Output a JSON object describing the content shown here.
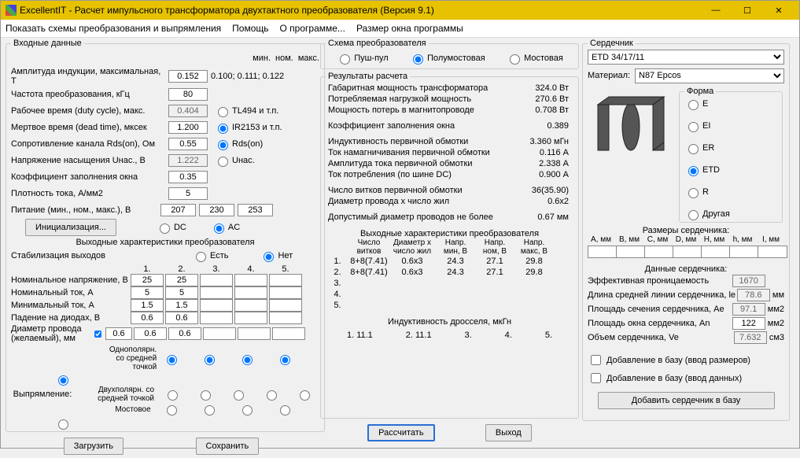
{
  "title": "ExcellentIT - Расчет импульсного трансформатора двухтактного преобразователя (Версия 9.1)",
  "menu": [
    "Показать схемы преобразования и выпрямления",
    "Помощь",
    "О программе...",
    "Размер окна программы"
  ],
  "sec": {
    "input": "Входные данные",
    "scheme": "Схема преобразователя",
    "results": "Результаты расчета",
    "outchar": "Выходные характеристики преобразователя",
    "outchar2": "Выходные характеристики преобразователя",
    "ind": "Индуктивность дросселя, мкГн",
    "core": "Сердечник",
    "coresize": "Размеры сердечника:",
    "coredata": "Данные сердечника:",
    "shape": "Форма"
  },
  "in": {
    "minnommax": [
      "мин.",
      "ном.",
      "макс."
    ],
    "ampl": "Амплитуда индукции, максимальная, Т",
    "ampl_v": "0.152",
    "ampl_ref": "0.100; 0.111; 0.122",
    "freq": "Частота преобразования, кГц",
    "freq_v": "80",
    "duty": "Рабочее время (duty cycle), макс.",
    "duty_v": "0.404",
    "tl": "TL494 и т.п.",
    "dead": "Мертвое время (dead time), мксек",
    "dead_v": "1.200",
    "ir": "IR2153 и т.п.",
    "rds": "Сопротивление канала Rds(on), Ом",
    "rds_v": "0.55",
    "rdson": "Rds(on)",
    "unac": "Напряжение насыщения Uнас., В",
    "unac_v": "1.222",
    "unac_r": "Uнас.",
    "kfill": "Коэффициент заполнения окна",
    "kfill_v": "0.35",
    "jdens": "Плотность тока, А/мм2",
    "jdens_v": "5",
    "power": "Питание (мин., ном., макс.), В",
    "p1": "207",
    "p2": "230",
    "p3": "253",
    "init": "Инициализация...",
    "dc": "DC",
    "ac": "AC",
    "stab": "Стабилизация выходов",
    "yes": "Есть",
    "no": "Нет",
    "cols": [
      "1.",
      "2.",
      "3.",
      "4.",
      "5."
    ],
    "vnom": "Номинальное напряжение, В",
    "vnom_v": [
      "25",
      "25",
      "",
      "",
      ""
    ],
    "inom": "Номинальный ток, А",
    "inom_v": [
      "5",
      "5",
      "",
      "",
      ""
    ],
    "imin": "Минимальный ток, А",
    "imin_v": [
      "1.5",
      "1.5",
      "",
      "",
      ""
    ],
    "diode": "Падение на диодах, В",
    "diode_v": [
      "0.6",
      "0.6",
      "",
      "",
      ""
    ],
    "wdia": "Диаметр провода (желаемый), мм",
    "wdia_m": "0.6",
    "wdia_v": [
      "0.6",
      "0.6",
      "",
      "",
      ""
    ],
    "rect": "Выпрямление:",
    "r1": "Однополярн. со средней точкой",
    "r2": "Двухполярн. со средней точкой",
    "r3": "Мостовое",
    "load": "Загрузить",
    "save": "Сохранить"
  },
  "scheme": {
    "pp": "Пуш-пул",
    "hb": "Полумостовая",
    "fb": "Мостовая"
  },
  "res": {
    "r1": "Габаритная мощность трансформатора",
    "v1": "324.0 Вт",
    "r2": "Потребляемая нагрузкой мощность",
    "v2": "270.6 Вт",
    "r3": "Мощность потерь в магнитопроводе",
    "v3": "0.708 Вт",
    "r4": "Коэффициент заполнения окна",
    "v4": "0.389",
    "r5": "Индуктивность первичной обмотки",
    "v5": "3.360 мГн",
    "r6": "Ток намагничивания первичной обмотки",
    "v6": "0.116 А",
    "r7": "Амплитуда тока первичной обмотки",
    "v7": "2.338 А",
    "r8": "Ток потребления (по шине DC)",
    "v8": "0.900 А",
    "r9": "Число витков первичной обмотки",
    "v9": "36(35.90)",
    "r10": "Диаметр провода x число жил",
    "v10": "0.6x2",
    "r11": "Допустимый диаметр проводов не более",
    "v11": "0.67 мм"
  },
  "out": {
    "h": [
      "",
      "Число витков",
      "Диаметр x число жил",
      "Напр. мин, В",
      "Напр. ном, В",
      "Напр. макс, В"
    ],
    "rows": [
      [
        "1.",
        "8+8(7.41)",
        "0.6x3",
        "24.3",
        "27.1",
        "29.8"
      ],
      [
        "2.",
        "8+8(7.41)",
        "0.6x3",
        "24.3",
        "27.1",
        "29.8"
      ],
      [
        "3.",
        "",
        "",
        "",
        "",
        ""
      ],
      [
        "4.",
        "",
        "",
        "",
        "",
        ""
      ],
      [
        "5.",
        "",
        "",
        "",
        "",
        ""
      ]
    ],
    "ind": [
      "1. 11.1",
      "2. 11.1",
      "3.",
      "4.",
      "5."
    ]
  },
  "btn": {
    "calc": "Рассчитать",
    "exit": "Выход",
    "add": "Добавить сердечник в базу"
  },
  "core": {
    "sel": "ETD 34/17/11",
    "mat": "Материал:",
    "mat_v": "N87 Epcos",
    "shapes": [
      "E",
      "EI",
      "ER",
      "ETD",
      "R",
      "Другая"
    ],
    "dims": [
      "A, мм",
      "B, мм",
      "C, мм",
      "D, мм",
      "H, мм",
      "h, мм",
      "I, мм"
    ],
    "d1": "Эффективная проницаемость",
    "d1v": "1670",
    "d2": "Длина средней линии сердечника, le",
    "d2v": "78.6",
    "u_mm": "мм",
    "d3": "Площадь сечения сердечника, Ae",
    "d3v": "97.1",
    "u_mm2": "мм2",
    "d4": "Площадь окна сердечника, An",
    "d4v": "122",
    "d5": "Объем сердечника, Ve",
    "d5v": "7.632",
    "u_cm3": "см3",
    "c1": "Добавление в базу (ввод размеров)",
    "c2": "Добавление в базу (ввод данных)"
  }
}
